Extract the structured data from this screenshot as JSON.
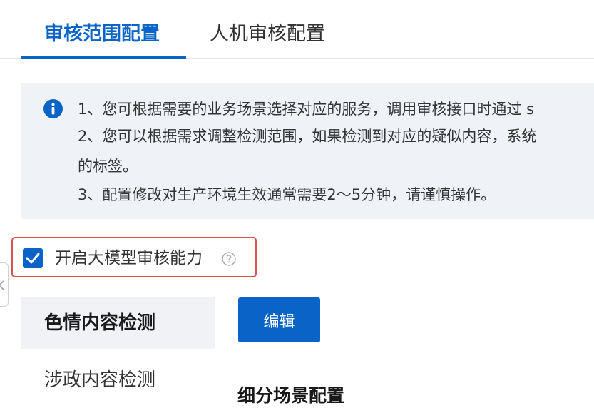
{
  "tabs": [
    {
      "label": "审核范围配置",
      "active": true
    },
    {
      "label": "人机审核配置",
      "active": false
    }
  ],
  "notice": {
    "icon": "info-icon",
    "lines": [
      "1、您可根据需要的业务场景选择对应的服务，调用审核接口时通过 s",
      "2、您可以根据需求调整检测范围，如果检测到对应的疑似内容，系统",
      "的标签。",
      "3、配置修改对生产环境生效通常需要2～5分钟，请谨慎操作。"
    ]
  },
  "llm_option": {
    "label": "开启大模型审核能力",
    "checked": true,
    "help_icon": "question-circle-icon"
  },
  "side_menu": {
    "items": [
      {
        "label": "色情内容检测",
        "active": true
      },
      {
        "label": "涉政内容检测",
        "active": false
      }
    ]
  },
  "main": {
    "edit_label": "编辑",
    "section_title": "细分场景配置"
  },
  "colors": {
    "primary": "#0a64c8",
    "notice_bg": "#eff3f8",
    "highlight_border": "#d9534f",
    "active_menu_bg": "#f0f2f5"
  }
}
